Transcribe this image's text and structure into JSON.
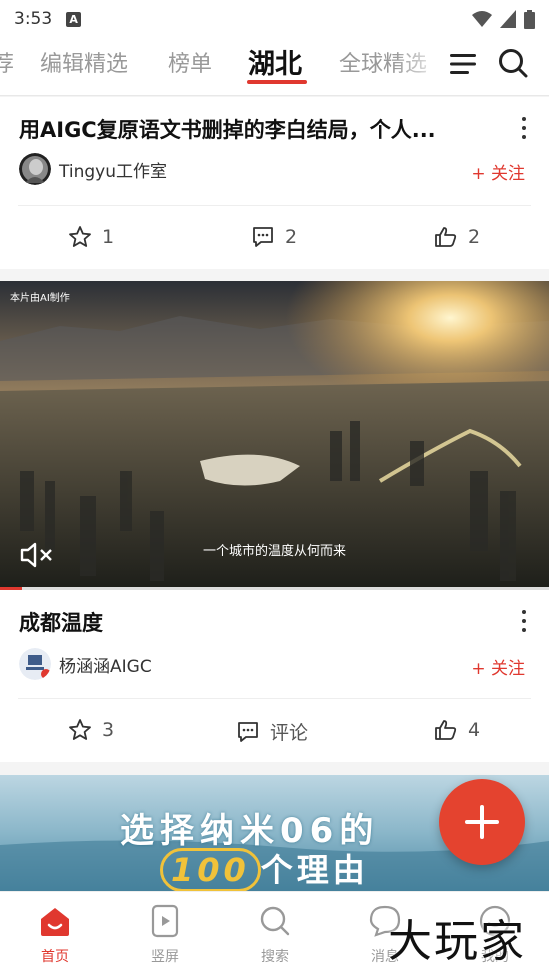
{
  "status_bar": {
    "time": "3:53",
    "notification_letter": "A"
  },
  "tabs": {
    "items": [
      {
        "label": "荐",
        "active": false
      },
      {
        "label": "编辑精选",
        "active": false
      },
      {
        "label": "榜单",
        "active": false
      },
      {
        "label": "湖北",
        "active": true
      },
      {
        "label": "全球精选",
        "active": false
      }
    ],
    "menu_icon": "menu-icon",
    "search_icon": "search-icon"
  },
  "feed": [
    {
      "title": "用AIGC复原语文书删掉的李白结局，个人...",
      "author": "Tingyu工作室",
      "follow_label": "+ 关注",
      "favorites": "1",
      "comments": "2",
      "likes": "2"
    },
    {
      "video_badge": "本片由AI制作",
      "video_caption": "一个城市的温度从何而来",
      "video_progress": 0.04,
      "title": "成都温度",
      "author": "杨涵涵AIGC",
      "follow_label": "+ 关注",
      "favorites": "3",
      "comments": "评论",
      "likes": "4"
    }
  ],
  "banner": {
    "line1": "选择纳米06的",
    "number": "100",
    "line2": "个理由"
  },
  "fab_icon": "plus-icon",
  "bottom_nav": [
    {
      "label": "首页",
      "icon": "home-icon",
      "active": true
    },
    {
      "label": "竖屏",
      "icon": "vertical-video-icon",
      "active": false
    },
    {
      "label": "搜索",
      "icon": "search-icon",
      "active": false
    },
    {
      "label": "消息",
      "icon": "message-icon",
      "active": false
    },
    {
      "label": "我的",
      "icon": "profile-icon",
      "active": false
    }
  ],
  "watermark": "大玩家",
  "colors": {
    "accent": "#e0382f",
    "fab": "#e4432f"
  }
}
